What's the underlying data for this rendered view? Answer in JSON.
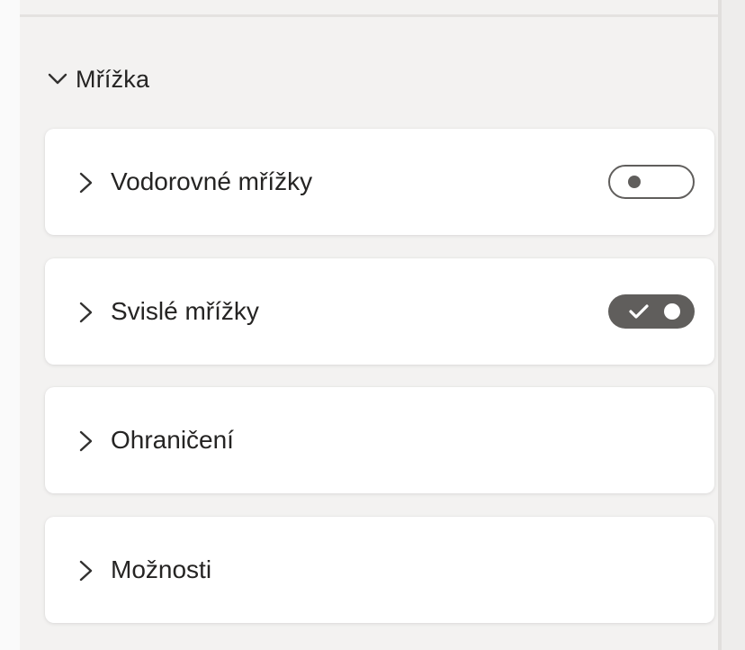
{
  "section": {
    "title": "Mřížka",
    "expanded": true,
    "icon": "chevron-down-icon"
  },
  "cards": [
    {
      "label": "Vodorovné mřížky",
      "icon": "chevron-right-icon",
      "toggle": "off"
    },
    {
      "label": "Svislé mřížky",
      "icon": "chevron-right-icon",
      "toggle": "on"
    },
    {
      "label": "Ohraničení",
      "icon": "chevron-right-icon"
    },
    {
      "label": "Možnosti",
      "icon": "chevron-right-icon"
    }
  ],
  "colors": {
    "pane_background": "#f3f2f1",
    "card_background": "#ffffff",
    "toggle_on": "#605e5c",
    "text": "#252423"
  }
}
